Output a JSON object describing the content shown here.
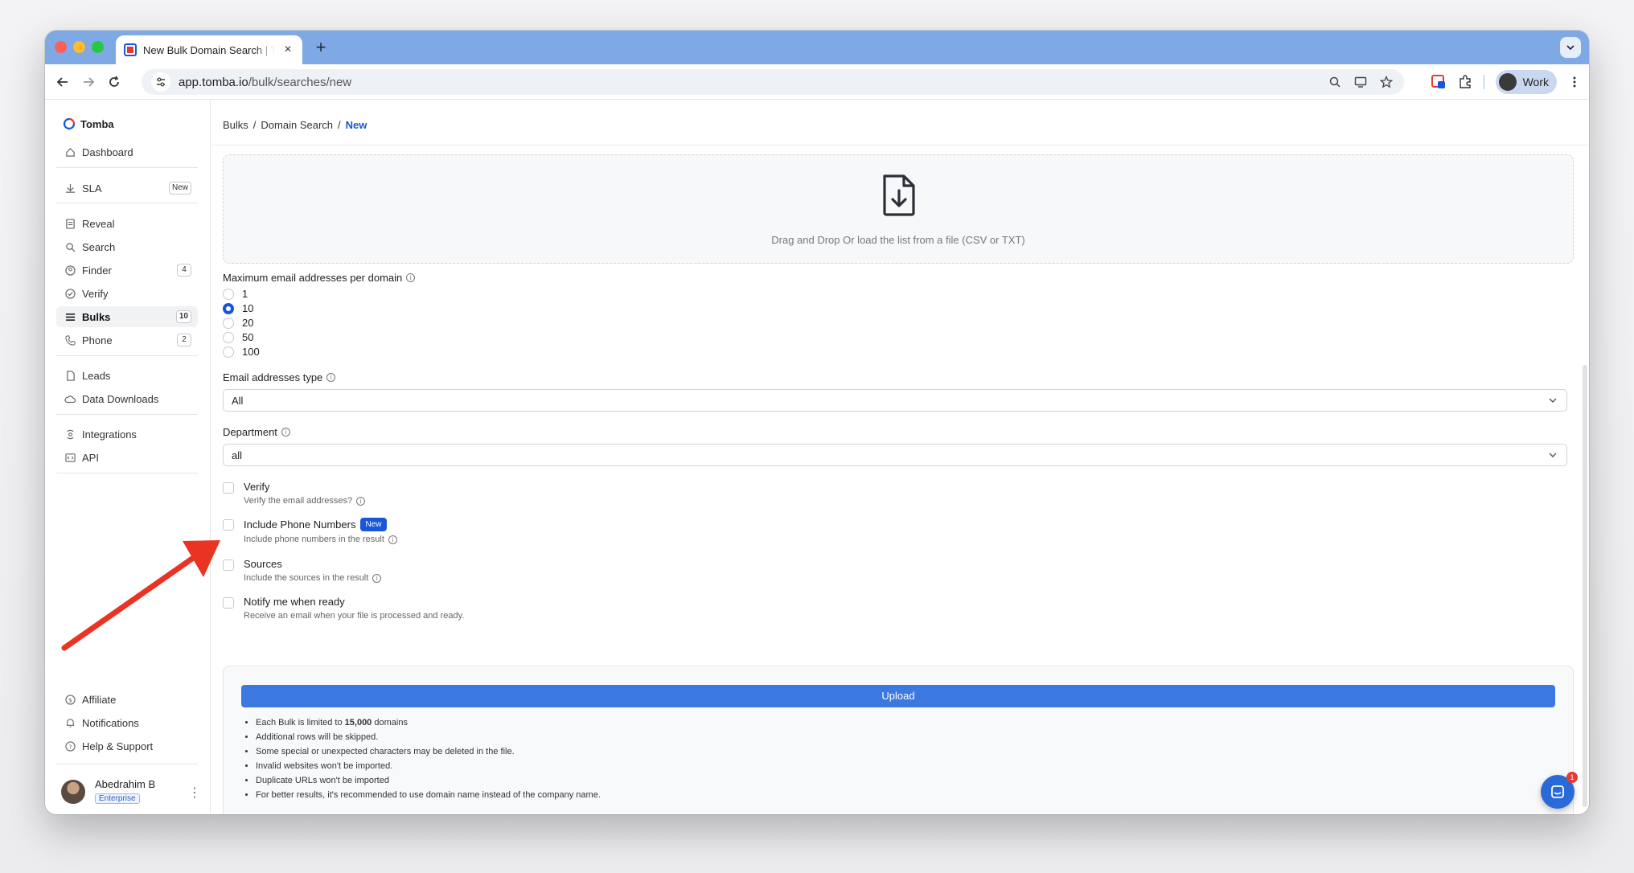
{
  "browser": {
    "tab_title": "New Bulk Domain Search | Tomba",
    "url_host": "app.tomba.io",
    "url_path": "/bulk/searches/new",
    "profile_label": "Work"
  },
  "sidebar": {
    "brand": "Tomba",
    "items": [
      {
        "label": "Dashboard"
      },
      {
        "label": "SLA",
        "badge": "New"
      },
      {
        "label": "Reveal"
      },
      {
        "label": "Search"
      },
      {
        "label": "Finder",
        "badge": "4"
      },
      {
        "label": "Verify"
      },
      {
        "label": "Bulks",
        "badge": "10"
      },
      {
        "label": "Phone",
        "badge": "2"
      },
      {
        "label": "Leads"
      },
      {
        "label": "Data Downloads"
      },
      {
        "label": "Integrations"
      },
      {
        "label": "API"
      }
    ],
    "bottom_items": [
      {
        "label": "Affiliate"
      },
      {
        "label": "Notifications"
      },
      {
        "label": "Help & Support"
      }
    ],
    "user": {
      "name": "Abedrahim B",
      "plan": "Enterprise"
    }
  },
  "breadcrumb": {
    "items": [
      "Bulks",
      "Domain Search",
      "New"
    ],
    "separator": "/"
  },
  "dropzone": {
    "text": "Drag and Drop Or load the list from a file (CSV or TXT)"
  },
  "form": {
    "max_emails_label": "Maximum email addresses per domain",
    "max_emails_options": [
      "1",
      "10",
      "20",
      "50",
      "100"
    ],
    "max_emails_selected": "10",
    "email_type_label": "Email addresses type",
    "email_type_value": "All",
    "department_label": "Department",
    "department_value": "all",
    "checks": [
      {
        "title": "Verify",
        "sub": "Verify the email addresses?"
      },
      {
        "title": "Include Phone Numbers",
        "badge": "New",
        "sub": "Include phone numbers in the result"
      },
      {
        "title": "Sources",
        "sub": "Include the sources in the result"
      },
      {
        "title": "Notify me when ready",
        "sub": "Receive an email when your file is processed and ready."
      }
    ]
  },
  "upload": {
    "button_label": "Upload",
    "notes_first_prefix": "Each Bulk is limited to ",
    "notes_first_bold": "15,000",
    "notes_first_suffix": " domains",
    "notes": [
      "Additional rows will be skipped.",
      "Some special or unexpected characters may be deleted in the file.",
      "Invalid websites won't be imported.",
      "Duplicate URLs won't be imported",
      "For better results, it's recommended to use domain name instead of the company name."
    ]
  },
  "chat": {
    "badge": "1"
  },
  "colors": {
    "accent": "#1a56db",
    "upload": "#3b78e0",
    "annotation_arrow": "#ea3323"
  }
}
